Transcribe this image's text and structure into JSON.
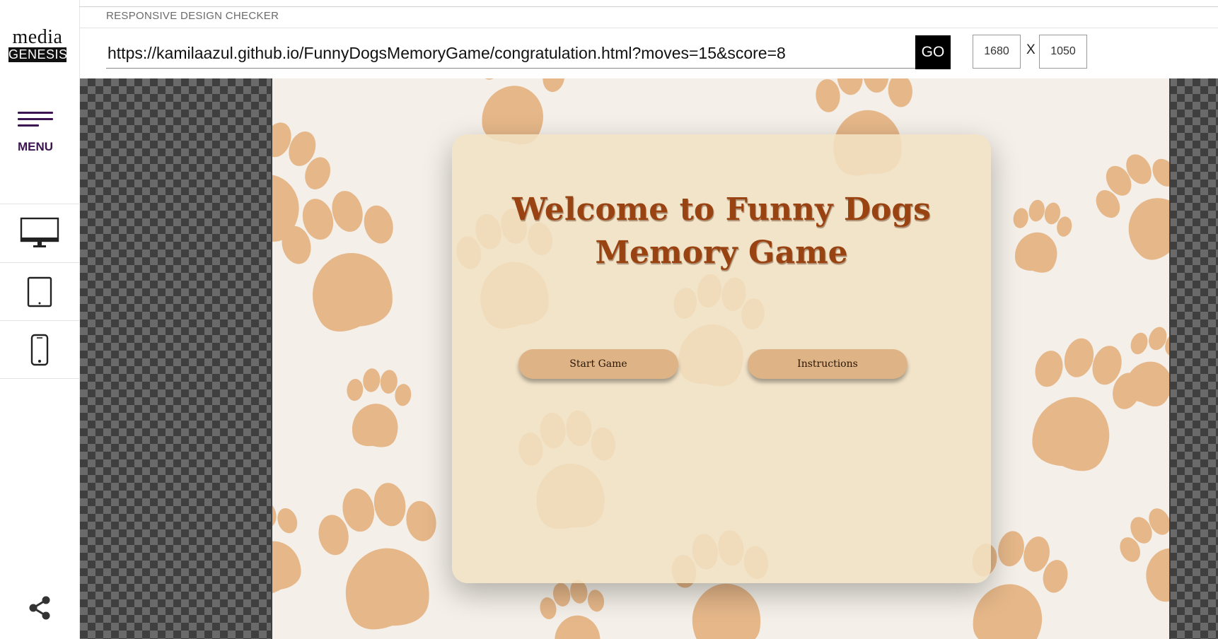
{
  "app": {
    "title": "RESPONSIVE DESIGN CHECKER",
    "logo_top": "media",
    "logo_bottom": "GENESIS"
  },
  "sidebar": {
    "menu_label": "MENU",
    "devices": [
      {
        "name": "desktop",
        "icon": "monitor-icon"
      },
      {
        "name": "tablet",
        "icon": "tablet-icon"
      },
      {
        "name": "mobile",
        "icon": "phone-icon"
      }
    ],
    "share_icon": "share-icon"
  },
  "toolbar": {
    "url": "https://kamilaazul.github.io/FunnyDogsMemoryGame/congratulation.html?moves=15&score=8",
    "go_label": "GO",
    "width": "1680",
    "separator": "X",
    "height": "1050"
  },
  "site": {
    "title_line1": "Welcome to Funny Dogs",
    "title_line2": "Memory Game",
    "start_button": "Start Game",
    "instructions_button": "Instructions"
  },
  "colors": {
    "brand_purple": "#3c1451",
    "go_button": "#000000",
    "title_brown": "#9a4312",
    "paw_color": "#e2ad78",
    "card_bg": "#f1e2c4",
    "page_bg": "#f4efe8"
  }
}
